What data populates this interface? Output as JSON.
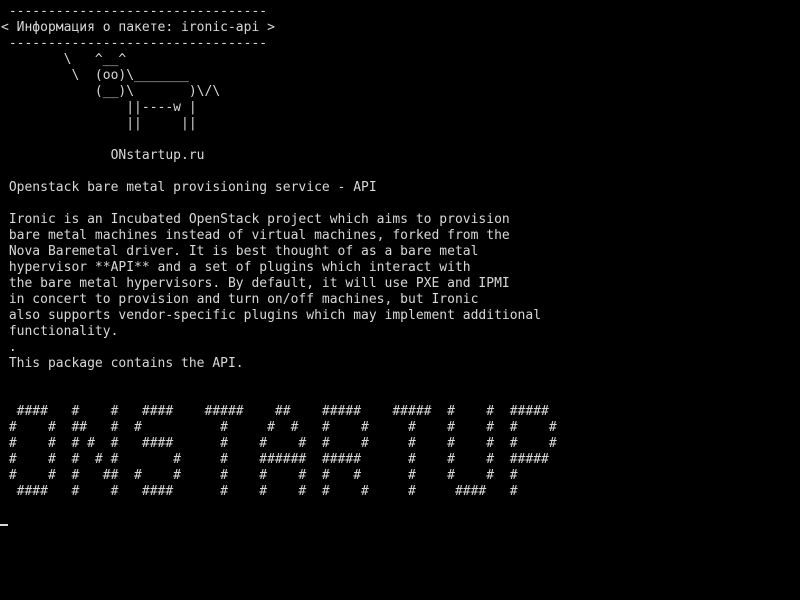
{
  "terminal": {
    "colors": {
      "background": "#000000",
      "foreground": "#d8d8d8"
    },
    "cowsay_bubble": [
      " ---------------------------------",
      "< Информация о пакете: ironic-api >",
      " ---------------------------------",
      "        \\   ^__^",
      "         \\  (oo)\\_______",
      "            (__)\\       )\\/\\",
      "                ||----w |",
      "                ||     ||"
    ],
    "spacer_1": "",
    "site": "              ONstartup.ru",
    "spacer_2": "",
    "summary": " Openstack bare metal provisioning service - API",
    "spacer_3": "",
    "description": [
      " Ironic is an Incubated OpenStack project which aims to provision",
      " bare metal machines instead of virtual machines, forked from the",
      " Nova Baremetal driver. It is best thought of as a bare metal",
      " hypervisor **API** and a set of plugins which interact with",
      " the bare metal hypervisors. By default, it will use PXE and IPMI",
      " in concert to provision and turn on/off machines, but Ironic",
      " also supports vendor-specific plugins which may implement additional",
      " functionality.",
      " .",
      " This package contains the API."
    ],
    "spacer_4": "",
    "spacer_5": "",
    "banner": [
      "  ####   #    #   ####    #####    ##    #####    #####  #    #  #####",
      " #    #  ##   #  #          #     #  #   #    #     #    #    #  #    #",
      " #    #  # #  #   ####      #    #    #  #    #     #    #    #  #    #",
      " #    #  #  # #       #     #    ######  #####      #    #    #  #####",
      " #    #  #   ##  #    #     #    #    #  #   #      #    #    #  #",
      "  ####   #    #   ####      #    #    #  #    #     #     ####   #"
    ]
  }
}
